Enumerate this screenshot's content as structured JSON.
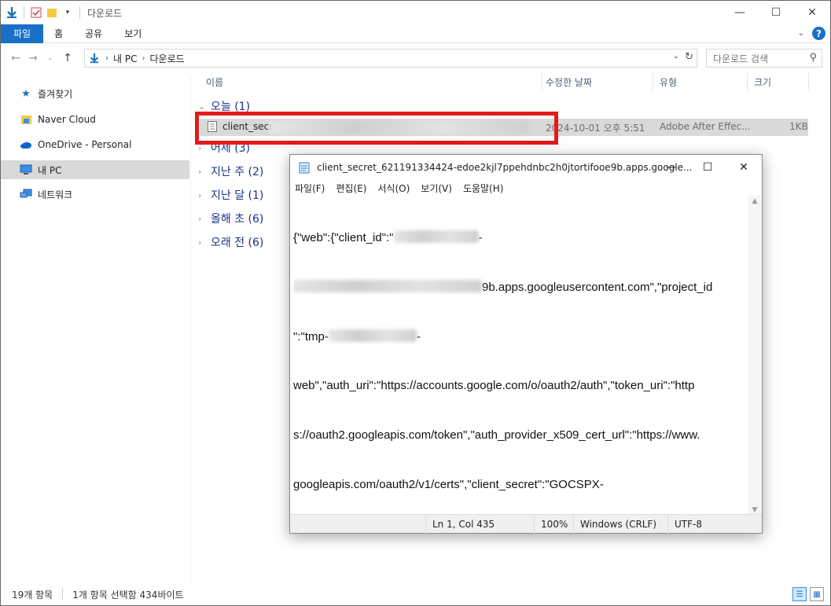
{
  "explorer": {
    "title": "다운로드",
    "ribbon_tabs": [
      "파일",
      "홈",
      "공유",
      "보기"
    ],
    "address": {
      "segments": [
        "내 PC",
        "다운로드"
      ]
    },
    "search_placeholder": "다운로드 검색",
    "sidebar": [
      {
        "label": "즐겨찾기",
        "icon": "star-icon"
      },
      {
        "label": "Naver Cloud",
        "icon": "folder-icon"
      },
      {
        "label": "OneDrive - Personal",
        "icon": "cloud-icon"
      },
      {
        "label": "내 PC",
        "icon": "pc-icon"
      },
      {
        "label": "네트워크",
        "icon": "network-icon"
      }
    ],
    "columns": [
      "이름",
      "수정한 날짜",
      "유형",
      "크기"
    ],
    "groups": [
      {
        "label": "오늘 (1)"
      },
      {
        "label": "어제 (3)"
      },
      {
        "label": "지난 주 (2)"
      },
      {
        "label": "지난 달 (1)"
      },
      {
        "label": "올해 초 (6)"
      },
      {
        "label": "오래 전 (6)"
      }
    ],
    "file": {
      "name": "client_secre",
      "date": "2024-10-01 오후 5:51",
      "type": "Adobe After Effec...",
      "size": "1KB"
    },
    "status": {
      "count": "19개 항목",
      "selection": "1개 항목 선택함 434바이트"
    }
  },
  "notepad": {
    "title": "client_secret_621191334424-edoe2kjl7ppehdnbc2h0jtortifooe9b.apps.google...",
    "menu": [
      "파일(F)",
      "편집(E)",
      "서식(O)",
      "보기(V)",
      "도움말(H)"
    ],
    "lines": [
      "{\"web\":{\"client_id\":\"",
      "9b.apps.googleusercontent.com\",\"project_id",
      "\":\"tmp-",
      "web\",\"auth_uri\":\"https://accounts.google.com/o/oauth2/auth\",\"token_uri\":\"http",
      "s://oauth2.googleapis.com/token\",\"auth_provider_x509_cert_url\":\"https://www.",
      "googleapis.com/oauth2/v1/certs\",\"client_secret\":\"GOCSPX-"
    ],
    "status": {
      "position": "Ln 1, Col 435",
      "zoom": "100%",
      "line_ending": "Windows (CRLF)",
      "encoding": "UTF-8"
    }
  },
  "colors": {
    "accent": "#1a6fc7",
    "highlight_box": "#e21b1b",
    "selection": "#d9d9d9"
  }
}
